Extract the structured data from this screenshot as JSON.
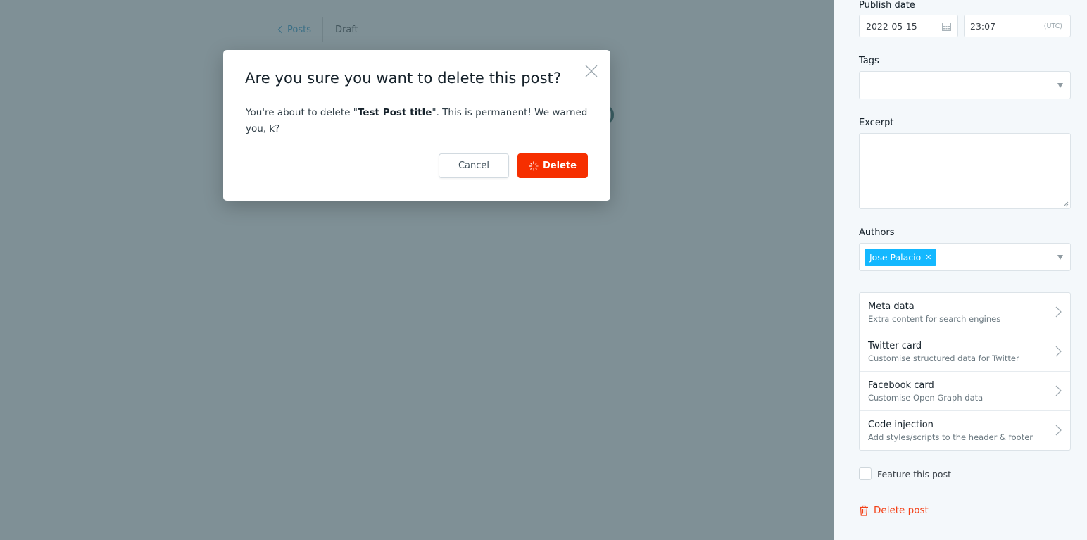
{
  "editor": {
    "breadcrumb_posts": "Posts",
    "status": "Draft"
  },
  "modal": {
    "title": "Are you sure you want to delete this post?",
    "body_before": "You're about to delete \"",
    "post_title": "Test Post title",
    "body_after": "\". This is permanent! We warned you, k?",
    "cancel_label": "Cancel",
    "delete_label": "Delete"
  },
  "sidebar": {
    "publish_date_label": "Publish date",
    "date_value": "2022-05-15",
    "time_value": "23:07",
    "timezone": "(UTC)",
    "tags_label": "Tags",
    "excerpt_label": "Excerpt",
    "authors_label": "Authors",
    "author_chip": "Jose Palacio",
    "settings": [
      {
        "title": "Meta data",
        "desc": "Extra content for search engines"
      },
      {
        "title": "Twitter card",
        "desc": "Customise structured data for Twitter"
      },
      {
        "title": "Facebook card",
        "desc": "Customise Open Graph data"
      },
      {
        "title": "Code injection",
        "desc": "Add styles/scripts to the header & footer"
      }
    ],
    "feature_label": "Feature this post",
    "delete_post_label": "Delete post"
  },
  "colors": {
    "overlay": "#7f9096",
    "danger": "#f62f00",
    "accent": "#14b8ff"
  }
}
